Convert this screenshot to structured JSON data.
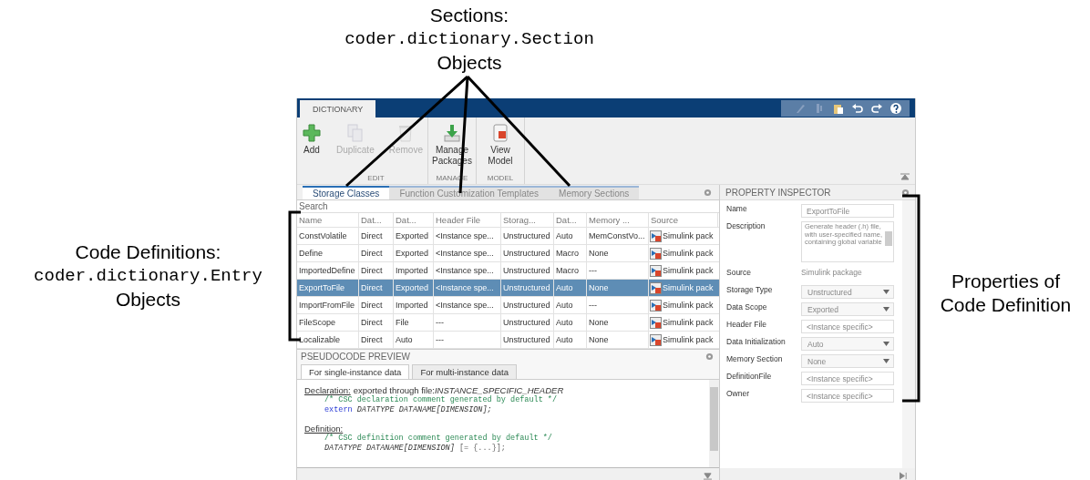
{
  "annotations": {
    "sections": {
      "title": "Sections:",
      "code": "coder.dictionary.Section",
      "suffix": "Objects"
    },
    "definitions": {
      "title": "Code Definitions:",
      "code": "coder.dictionary.Entry",
      "suffix": "Objects"
    },
    "properties": {
      "lines": [
        "Properties of",
        "Code Definition"
      ]
    }
  },
  "toolstrip": {
    "tabs": [
      {
        "label": "DICTIONARY",
        "selected": true
      }
    ],
    "quick_access": [
      {
        "disabled": true
      },
      {
        "disabled": true
      },
      {
        "disabled": false
      },
      {
        "disabled": false
      },
      {
        "disabled": false
      },
      {
        "disabled": false
      }
    ],
    "groups": [
      {
        "label": "EDIT",
        "buttons": [
          {
            "label": "Add",
            "disabled": false
          },
          {
            "label": "Duplicate",
            "disabled": true
          },
          {
            "label": "Remove",
            "disabled": true
          }
        ]
      },
      {
        "label": "MANAGE",
        "buttons": [
          {
            "label": "Manage Packages",
            "disabled": false
          }
        ]
      },
      {
        "label": "MODEL",
        "buttons": [
          {
            "label": "View Model",
            "disabled": false
          }
        ]
      }
    ]
  },
  "section_tabs": [
    {
      "label": "Storage Classes",
      "selected": true
    },
    {
      "label": "Function Customization Templates",
      "selected": false
    },
    {
      "label": "Memory Sections",
      "selected": false
    }
  ],
  "search": {
    "placeholder": "Search"
  },
  "table": {
    "columns": [
      "Name",
      "Dat...",
      "Dat...",
      "Header File",
      "Storag...",
      "Dat...",
      "Memory ...",
      "Source"
    ],
    "rows": [
      {
        "selected": false,
        "cells": [
          "ConstVolatile",
          "Direct",
          "Exported",
          "<Instance spe...",
          "Unstructured",
          "Auto",
          "MemConstVo...",
          "Simulink pack"
        ]
      },
      {
        "selected": false,
        "cells": [
          "Define",
          "Direct",
          "Exported",
          "<Instance spe...",
          "Unstructured",
          "Macro",
          "None",
          "Simulink pack"
        ]
      },
      {
        "selected": false,
        "cells": [
          "ImportedDefine",
          "Direct",
          "Imported",
          "<Instance spe...",
          "Unstructured",
          "Macro",
          "---",
          "Simulink pack"
        ]
      },
      {
        "selected": true,
        "cells": [
          "ExportToFile",
          "Direct",
          "Exported",
          "<Instance spe...",
          "Unstructured",
          "Auto",
          "None",
          "Simulink pack"
        ]
      },
      {
        "selected": false,
        "cells": [
          "ImportFromFile",
          "Direct",
          "Imported",
          "<Instance spe...",
          "Unstructured",
          "Auto",
          "---",
          "Simulink pack"
        ]
      },
      {
        "selected": false,
        "cells": [
          "FileScope",
          "Direct",
          "File",
          "---",
          "Unstructured",
          "Auto",
          "None",
          "Simulink pack"
        ]
      },
      {
        "selected": false,
        "cells": [
          "Localizable",
          "Direct",
          "Auto",
          "---",
          "Unstructured",
          "Auto",
          "None",
          "Simulink pack"
        ]
      }
    ]
  },
  "pseudocode": {
    "title": "PSEUDOCODE PREVIEW",
    "tabs": [
      {
        "label": "For single-instance data",
        "selected": true
      },
      {
        "label": "For multi-instance data",
        "selected": false
      }
    ],
    "sections": [
      {
        "heading": "Declaration:",
        "note": "exported through file:*INSTANCE_SPECIFIC_HEADER*",
        "lines": [
          [
            {
              "kind": "comment",
              "text": "/* CSC declaration comment generated by default */"
            }
          ],
          [
            {
              "kind": "keyword",
              "text": "extern "
            },
            {
              "kind": "code",
              "text": "DATATYPE DATANAME[DIMENSION];"
            }
          ]
        ]
      },
      {
        "heading": "Definition:",
        "lines": [
          [
            {
              "kind": "comment",
              "text": "/* CSC definition comment generated by default */"
            }
          ],
          [
            {
              "kind": "code",
              "text": "DATATYPE DATANAME[DIMENSION]"
            },
            {
              "kind": "plain",
              "text": " [= {...}];"
            }
          ]
        ]
      }
    ]
  },
  "inspector": {
    "title": "PROPERTY INSPECTOR",
    "properties": [
      {
        "label": "Name",
        "kind": "input",
        "value": "ExportToFile"
      },
      {
        "label": "Description",
        "kind": "textarea",
        "value": "Generate header (.h) file, with user-specified name, containing global variable"
      },
      {
        "label": "Source",
        "kind": "static",
        "value": "Simulink package"
      },
      {
        "label": "Storage Type",
        "kind": "dropdown",
        "value": "Unstructured"
      },
      {
        "label": "Data Scope",
        "kind": "dropdown",
        "value": "Exported"
      },
      {
        "label": "Header File",
        "kind": "input",
        "value": "<Instance specific>"
      },
      {
        "label": "Data Initialization",
        "kind": "dropdown",
        "value": "Auto"
      },
      {
        "label": "Memory Section",
        "kind": "dropdown",
        "value": "None"
      },
      {
        "label": "DefinitionFile",
        "kind": "input",
        "value": "<Instance specific>"
      },
      {
        "label": "Owner",
        "kind": "input",
        "value": "<Instance specific>"
      }
    ]
  }
}
